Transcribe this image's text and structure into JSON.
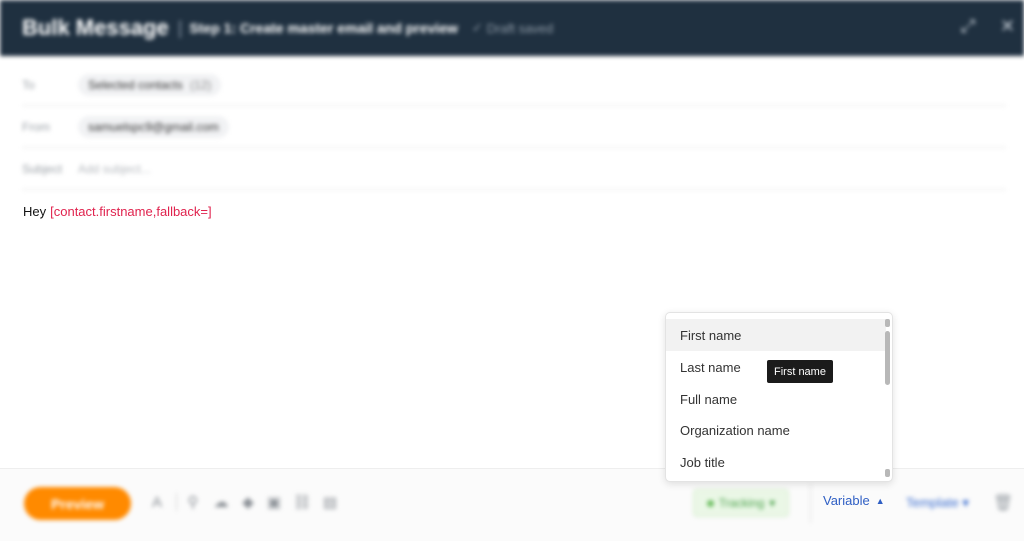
{
  "header": {
    "title": "Bulk Message",
    "separator": "|",
    "step": "Step 1: Create master email and preview",
    "saved_icon": "check-icon",
    "saved_text": "Draft saved",
    "expand_icon": "expand-icon",
    "close_icon": "close-icon"
  },
  "fields": {
    "to_label": "To",
    "to_value": "Selected contacts",
    "to_count": "(12)",
    "from_label": "From",
    "from_value": "samuelspc9@gmail.com",
    "subject_label": "Subject",
    "subject_placeholder": "Add subject..."
  },
  "body": {
    "greeting": "Hey",
    "variable": "[contact.firstname,fallback=]"
  },
  "footer": {
    "preview_label": "Preview",
    "tracking_label": "Tracking",
    "tracking_caret": "▾",
    "variable_label": "Variable",
    "variable_caret": "▲",
    "template_label": "Template",
    "template_caret": "▾",
    "icons": [
      "text-format-icon",
      "attachment-icon",
      "cloud-upload-icon",
      "dropbox-icon",
      "document-icon",
      "link-icon",
      "image-icon",
      "trash-icon"
    ]
  },
  "dropdown": {
    "items": [
      "First name",
      "Last name",
      "Full name",
      "Organization name",
      "Job title"
    ],
    "selected": "First name"
  },
  "tooltip": {
    "text": "First name"
  },
  "colors": {
    "header_bg": "#1f3040",
    "accent_orange": "#ff8a00",
    "variable_red": "#e0234e",
    "link_blue": "#2f5fc4"
  }
}
